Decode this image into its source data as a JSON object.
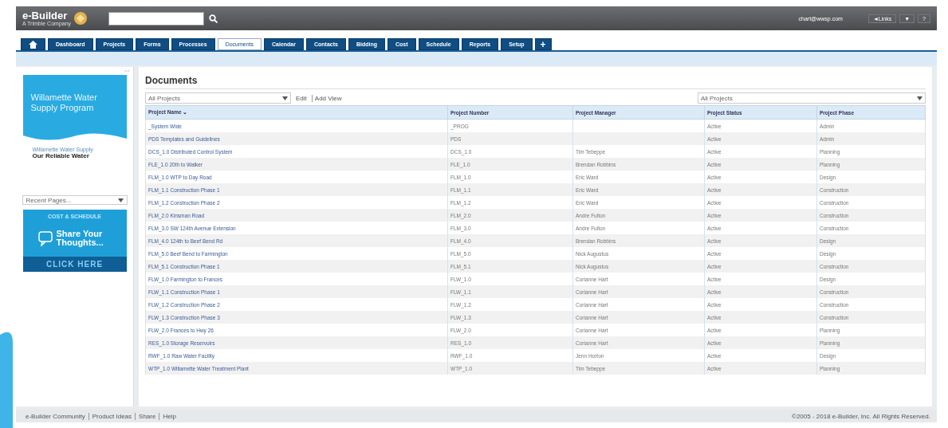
{
  "top_bar": {
    "logo": "e-Builder",
    "logo_subtitle": "A Trimble Company",
    "user": "chart@wwsp.com",
    "links": [
      "◄Links",
      "▼",
      "?"
    ]
  },
  "tabs": [
    {
      "kind": "home",
      "selected": false
    },
    {
      "kind": "text",
      "label": "Dashboard",
      "selected": false
    },
    {
      "kind": "text",
      "label": "Projects",
      "selected": false
    },
    {
      "kind": "text",
      "label": "Forms",
      "selected": false
    },
    {
      "kind": "text",
      "label": "Processes",
      "selected": false
    },
    {
      "kind": "text",
      "label": "Documents",
      "selected": true
    },
    {
      "kind": "text",
      "label": "Calendar",
      "selected": false
    },
    {
      "kind": "text",
      "label": "Contacts",
      "selected": false
    },
    {
      "kind": "text",
      "label": "Bidding",
      "selected": false
    },
    {
      "kind": "text",
      "label": "Cost",
      "selected": false
    },
    {
      "kind": "text",
      "label": "Schedule",
      "selected": false
    },
    {
      "kind": "text",
      "label": "Reports",
      "selected": false
    },
    {
      "kind": "text",
      "label": "Setup",
      "selected": false
    },
    {
      "kind": "add",
      "label": "+",
      "selected": false
    }
  ],
  "sidebar": {
    "collapse": "<<",
    "program_banner": {
      "title": "Willamette Water Supply Program",
      "subtitle": "Willamette Water Supply",
      "tagline": "Our Reliable Water"
    },
    "recent_pages": "Recent Pages...",
    "feedback_banner": {
      "heading": "COST & SCHEDULE",
      "title": "Share Your Thoughts...",
      "action": "CLICK HERE"
    }
  },
  "page": {
    "title": "Documents",
    "view_select": "All Projects",
    "view_links": [
      "Edit",
      "Add View"
    ],
    "filter_select": "All Projects"
  },
  "table": {
    "columns": [
      "Project Name ⌄",
      "Project Number",
      "Project Manager",
      "Project Status",
      "Project Phase"
    ],
    "rows": [
      [
        "_System Wide",
        "_PROG",
        "",
        "Active",
        "Admin"
      ],
      [
        "PDS Templates and Guidelines",
        "PDS",
        "",
        "Active",
        "Admin"
      ],
      [
        "DCS_1.0 Distributed Control System",
        "DCS_1.0",
        "Tim Tebeppe",
        "Active",
        "Planning"
      ],
      [
        "FLE_1.0 20th to Walker",
        "FLE_1.0",
        "Brendan Robbins",
        "Active",
        "Planning"
      ],
      [
        "FLM_1.0 WTP to Day Road",
        "FLM_1.0",
        "Eric Ward",
        "Active",
        "Design"
      ],
      [
        "FLM_1.1 Construction Phase 1",
        "FLM_1.1",
        "Eric Ward",
        "Active",
        "Construction"
      ],
      [
        "FLM_1.2 Construction Phase 2",
        "FLM_1.2",
        "Eric Ward",
        "Active",
        "Construction"
      ],
      [
        "FLM_2.0 Kinsman Road",
        "FLM_2.0",
        "Andre Fulton",
        "Active",
        "Construction"
      ],
      [
        "FLM_3.0 SW 124th Avenue Extension",
        "FLM_3.0",
        "Andre Fulton",
        "Active",
        "Construction"
      ],
      [
        "FLM_4.0 124th to Beef Bend Rd",
        "FLM_4.0",
        "Brendan Robbins",
        "Active",
        "Design"
      ],
      [
        "FLM_5.0 Beef Bend to Farmington",
        "FLM_5.0",
        "Nick Augustus",
        "Active",
        "Design"
      ],
      [
        "FLM_5.1 Construction Phase 1",
        "FLM_5.1",
        "Nick Augustus",
        "Active",
        "Construction"
      ],
      [
        "FLW_1.0 Farmington to Frances",
        "FLW_1.0",
        "Corianne Hart",
        "Active",
        "Design"
      ],
      [
        "FLW_1.1 Construction Phase 1",
        "FLW_1.1",
        "Corianne Hart",
        "Active",
        "Construction"
      ],
      [
        "FLW_1.2 Construction Phase 2",
        "FLW_1.2",
        "Corianne Hart",
        "Active",
        "Construction"
      ],
      [
        "FLW_1.3 Construction Phase 3",
        "FLW_1.3",
        "Corianne Hart",
        "Active",
        "Construction"
      ],
      [
        "FLW_2.0 Frances to Hwy 26",
        "FLW_2.0",
        "Corianne Hart",
        "Active",
        "Planning"
      ],
      [
        "RES_1.0 Storage Reservoirs",
        "RES_1.0",
        "Corianne Hart",
        "Active",
        "Planning"
      ],
      [
        "RWF_1.0 Raw Water Facility",
        "RWF_1.0",
        "Jenn Horton",
        "Active",
        "Design"
      ],
      [
        "WTP_1.0 Willamette Water Treatment Plant",
        "WTP_1.0",
        "Tim Tebeppe",
        "Active",
        "Planning"
      ]
    ]
  },
  "footer": {
    "links": [
      "e-Builder Community",
      "Product Ideas",
      "Share",
      "Help"
    ],
    "copyright": "©2005 - 2018 e-Builder, Inc. All Rights Reserved."
  }
}
